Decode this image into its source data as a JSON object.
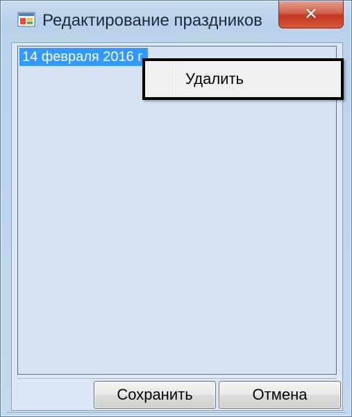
{
  "window": {
    "title": "Редактирование праздников",
    "close_symbol": "✕"
  },
  "icons": {
    "app": "app-window-icon",
    "close": "close-icon"
  },
  "list": {
    "items": [
      {
        "label": "14 февраля 2016 г.",
        "selected": true
      }
    ]
  },
  "context_menu": {
    "items": [
      {
        "label": "Удалить"
      }
    ]
  },
  "buttons": {
    "save_label": "Сохранить",
    "cancel_label": "Отмена"
  },
  "colors": {
    "selection": "#3399ff",
    "close_button": "#c2391f",
    "window_frame": "#b9d1ea"
  }
}
